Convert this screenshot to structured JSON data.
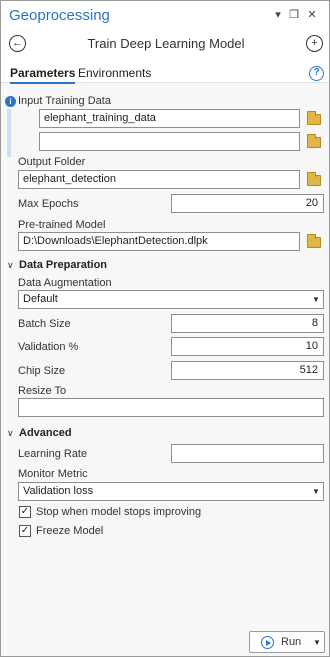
{
  "window": {
    "app_title": "Geoprocessing",
    "pin_glyph": "▾",
    "restore_glyph": "❐",
    "close_glyph": "✕"
  },
  "tool": {
    "title": "Train Deep Learning Model",
    "back_icon": "back-arrow-icon",
    "add_icon": "add-icon"
  },
  "tabs": {
    "parameters": "Parameters",
    "environments": "Environments",
    "help_glyph": "?"
  },
  "params": {
    "input_training_data": {
      "label": "Input Training Data",
      "values": [
        "elephant_training_data",
        ""
      ]
    },
    "output_folder": {
      "label": "Output Folder",
      "value": "elephant_detection"
    },
    "max_epochs": {
      "label": "Max Epochs",
      "value": "20"
    },
    "pretrained_model": {
      "label": "Pre-trained Model",
      "value": "D:\\Downloads\\ElephantDetection.dlpk"
    }
  },
  "data_preparation": {
    "heading": "Data Preparation",
    "data_augmentation": {
      "label": "Data Augmentation",
      "value": "Default"
    },
    "batch_size": {
      "label": "Batch Size",
      "value": "8"
    },
    "validation": {
      "label": "Validation %",
      "value": "10"
    },
    "chip_size": {
      "label": "Chip Size",
      "value": "512"
    },
    "resize_to": {
      "label": "Resize To",
      "value": ""
    }
  },
  "advanced": {
    "heading": "Advanced",
    "learning_rate": {
      "label": "Learning Rate",
      "value": ""
    },
    "monitor_metric": {
      "label": "Monitor Metric",
      "value": "Validation loss"
    },
    "stop_improving": {
      "label": "Stop when model stops improving",
      "checked": true
    },
    "freeze_model": {
      "label": "Freeze Model",
      "checked": true
    }
  },
  "run": {
    "label": "Run"
  },
  "colors": {
    "accent": "#2a74c9",
    "folder": "#e2b646"
  }
}
